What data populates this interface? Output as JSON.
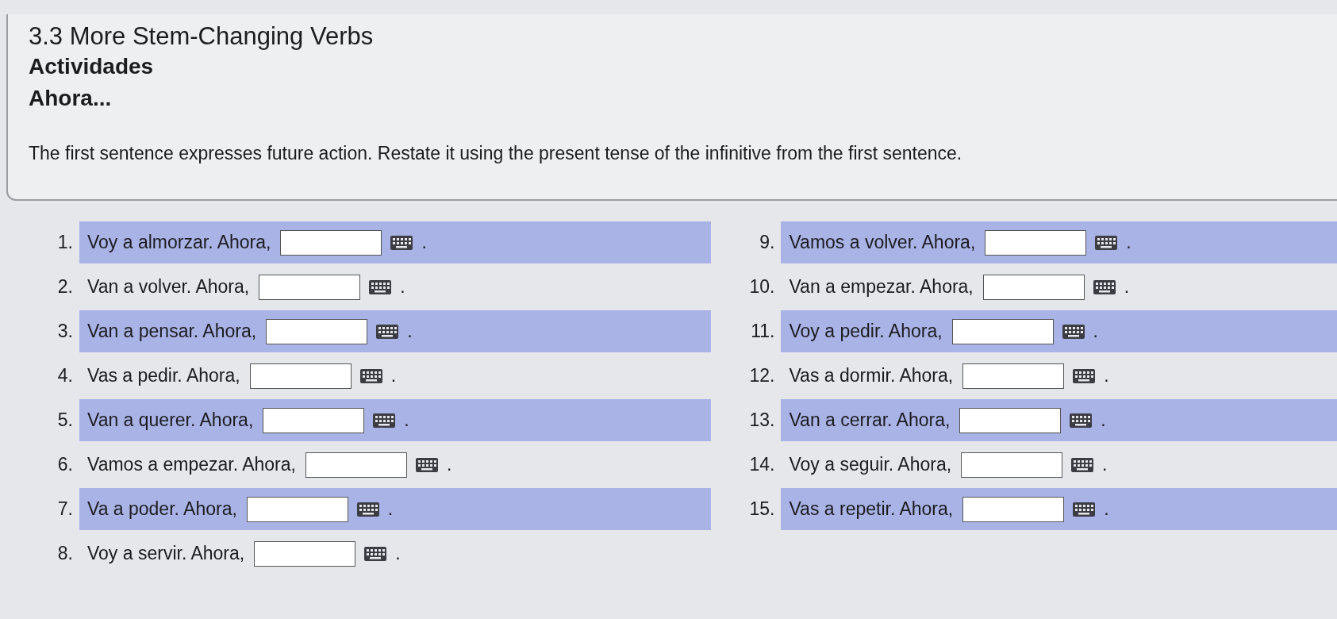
{
  "header": {
    "title": "3.3 More Stem-Changing Verbs",
    "section": "Actividades",
    "activity": "Ahora...",
    "instructions": "The first sentence expresses future action. Restate it using the present tense of the infinitive from the first sentence."
  },
  "columns": [
    {
      "items": [
        {
          "number": "1.",
          "prompt": "Voy a almorzar. Ahora,",
          "end": ".",
          "shaded": true
        },
        {
          "number": "2.",
          "prompt": "Van a volver. Ahora,",
          "end": ".",
          "shaded": false
        },
        {
          "number": "3.",
          "prompt": "Van a pensar. Ahora,",
          "end": ".",
          "shaded": true
        },
        {
          "number": "4.",
          "prompt": "Vas a pedir. Ahora,",
          "end": ".",
          "shaded": false
        },
        {
          "number": "5.",
          "prompt": "Van a querer. Ahora,",
          "end": ".",
          "shaded": true
        },
        {
          "number": "6.",
          "prompt": "Vamos a empezar. Ahora,",
          "end": ".",
          "shaded": false
        },
        {
          "number": "7.",
          "prompt": "Va a poder. Ahora,",
          "end": ".",
          "shaded": true
        },
        {
          "number": "8.",
          "prompt": "Voy a servir. Ahora,",
          "end": ".",
          "shaded": false
        }
      ]
    },
    {
      "items": [
        {
          "number": "9.",
          "prompt": "Vamos a volver. Ahora,",
          "end": ".",
          "shaded": true
        },
        {
          "number": "10.",
          "prompt": "Van a empezar. Ahora,",
          "end": ".",
          "shaded": false
        },
        {
          "number": "11.",
          "prompt": "Voy a pedir. Ahora,",
          "end": ".",
          "shaded": true
        },
        {
          "number": "12.",
          "prompt": "Vas a dormir. Ahora,",
          "end": ".",
          "shaded": false
        },
        {
          "number": "13.",
          "prompt": "Van a cerrar. Ahora,",
          "end": ".",
          "shaded": true
        },
        {
          "number": "14.",
          "prompt": "Voy a seguir. Ahora,",
          "end": ".",
          "shaded": false
        },
        {
          "number": "15.",
          "prompt": "Vas a repetir. Ahora,",
          "end": ".",
          "shaded": true
        }
      ]
    }
  ]
}
